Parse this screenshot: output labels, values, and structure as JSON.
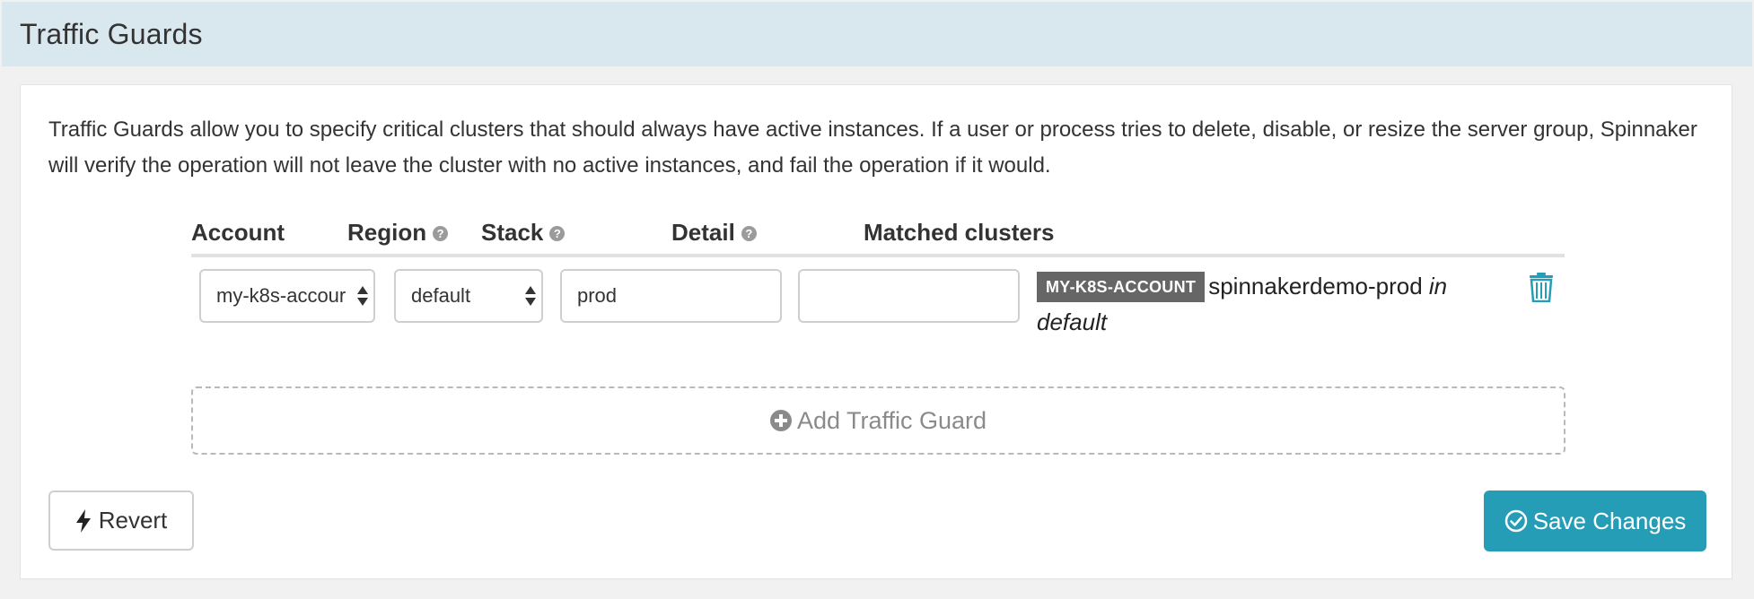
{
  "section": {
    "title": "Traffic Guards"
  },
  "description": "Traffic Guards allow you to specify critical clusters that should always have active instances. If a user or process tries to delete, disable, or resize the server group, Spinnaker will verify the operation will not leave the cluster with no active instances, and fail the operation if it would.",
  "table": {
    "headers": {
      "account": "Account",
      "region": "Region",
      "stack": "Stack",
      "detail": "Detail",
      "matched": "Matched clusters"
    },
    "help_glyph": "?",
    "rows": [
      {
        "account": "my-k8s-accour",
        "region": "default",
        "stack": "prod",
        "detail": "",
        "matched": {
          "account_badge": "MY-K8S-ACCOUNT",
          "cluster": "spinnakerdemo-prod",
          "in_word": "in",
          "region": "default"
        }
      }
    ]
  },
  "actions": {
    "add_guard_label": "Add Traffic Guard",
    "revert_label": "Revert",
    "save_label": "Save Changes"
  },
  "icons": {
    "help": "question-circle-icon",
    "delete": "trash-icon",
    "add": "plus-circle-icon",
    "revert": "bolt-icon",
    "save": "check-circle-icon"
  },
  "colors": {
    "header_bg": "#d9e8ee",
    "accent": "#269db7",
    "badge_bg": "#666666",
    "page_bg": "#f1f1f1"
  }
}
